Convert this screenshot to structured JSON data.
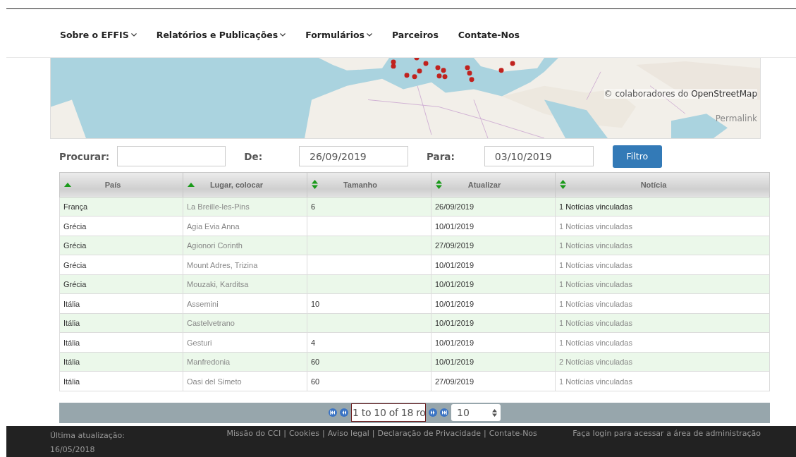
{
  "nav": [
    {
      "label": "Sobre o EFFIS",
      "dropdown": true
    },
    {
      "label": "Relatórios e Publicações",
      "dropdown": true
    },
    {
      "label": "Formulários",
      "dropdown": true
    },
    {
      "label": "Parceiros",
      "dropdown": false
    },
    {
      "label": "Contate-Nos",
      "dropdown": false
    }
  ],
  "map": {
    "attribution_prefix": "© colaboradores do",
    "attribution_link": "OpenStreetMap",
    "permalink": "Permalink"
  },
  "filter": {
    "search_label": "Procurar:",
    "from_label": "De:",
    "from_value": "26/09/2019",
    "to_label": "Para:",
    "to_value": "03/10/2019",
    "button": "Filtro"
  },
  "table": {
    "columns": [
      {
        "label": "País",
        "sorted": true
      },
      {
        "label": "Lugar, colocar",
        "sorted": true
      },
      {
        "label": "Tamanho",
        "sorted": false
      },
      {
        "label": "Atualizar",
        "sorted": false
      },
      {
        "label": "Notícia",
        "sorted": false
      }
    ],
    "rows": [
      {
        "cells": [
          "França",
          "La Breille-les-Pins",
          "6",
          "26/09/2019",
          "1 Notícias vinculadas"
        ],
        "selected": true
      },
      {
        "cells": [
          "Grécia",
          "Agia Evia Anna",
          "",
          "10/01/2019",
          "1 Notícias vinculadas"
        ],
        "selected": false
      },
      {
        "cells": [
          "Grécia",
          "Agionori Corinth",
          "",
          "27/09/2019",
          "1 Notícias vinculadas"
        ],
        "selected": false
      },
      {
        "cells": [
          "Grécia",
          "Mount Adres, Trizina",
          "",
          "10/01/2019",
          "1 Notícias vinculadas"
        ],
        "selected": false
      },
      {
        "cells": [
          "Grécia",
          "Mouzaki, Karditsa",
          "",
          "10/01/2019",
          "1 Notícias vinculadas"
        ],
        "selected": false
      },
      {
        "cells": [
          "Itália",
          "Assemini",
          "10",
          "10/01/2019",
          "1 Notícias vinculadas"
        ],
        "selected": false
      },
      {
        "cells": [
          "Itália",
          "Castelvetrano",
          "",
          "10/01/2019",
          "1 Notícias vinculadas"
        ],
        "selected": false
      },
      {
        "cells": [
          "Itália",
          "Gesturi",
          "4",
          "10/01/2019",
          "1 Notícias vinculadas"
        ],
        "selected": false
      },
      {
        "cells": [
          "Itália",
          "Manfredonia",
          "60",
          "10/01/2019",
          "2 Notícias vinculadas"
        ],
        "selected": false
      },
      {
        "cells": [
          "Itália",
          "Oasi del Simeto",
          "60",
          "27/09/2019",
          "1 Notícias vinculadas"
        ],
        "selected": false
      }
    ]
  },
  "pager": {
    "range": "1 to 10 of 18 ro",
    "page_size": "10"
  },
  "footer": {
    "updated_label": "Última atualização:",
    "updated_date": "16/05/2018",
    "links": [
      "Missão do CCI",
      "Cookies",
      "Aviso legal",
      "Declaração de Privacidade",
      "Contate-Nos"
    ],
    "separator": "|",
    "login": "Faça login para acessar a área de administração"
  }
}
